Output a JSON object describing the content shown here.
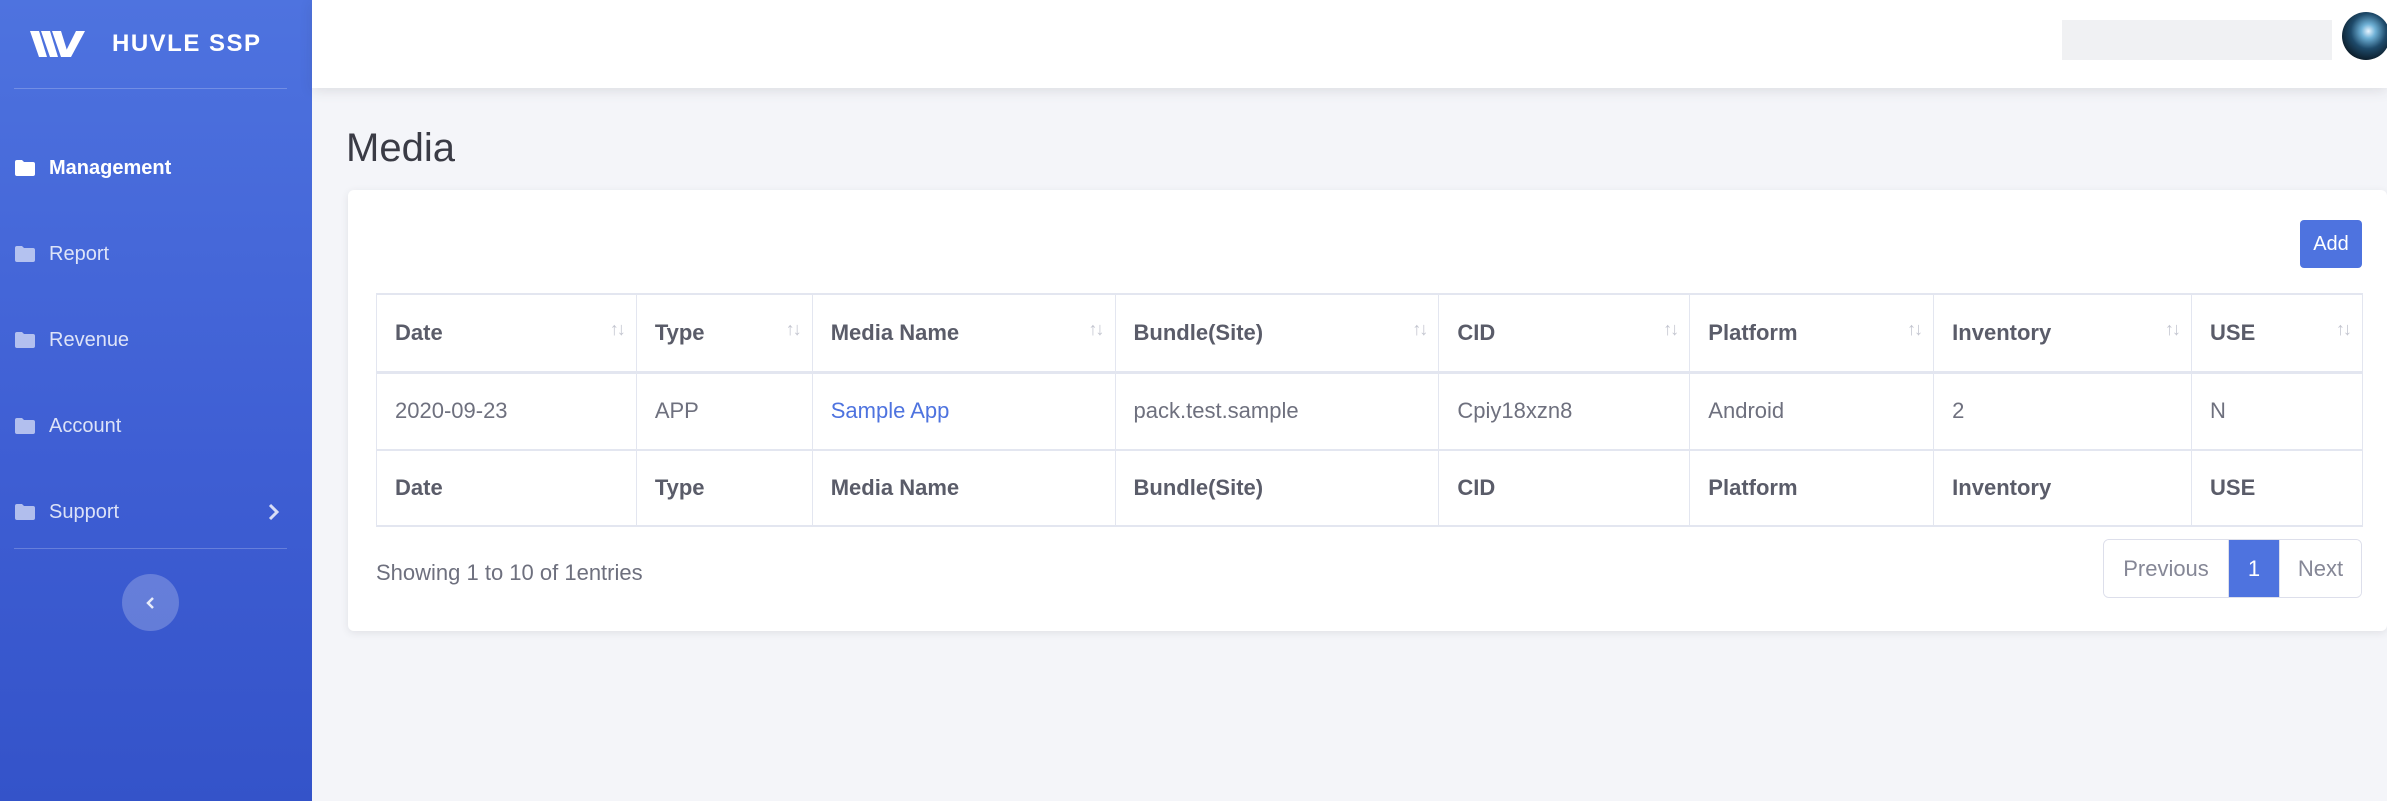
{
  "brand": {
    "name": "HUVLE SSP"
  },
  "sidebar": {
    "items": [
      {
        "label": "Management",
        "icon": "folder-icon",
        "active": true
      },
      {
        "label": "Report",
        "icon": "folder-icon"
      },
      {
        "label": "Revenue",
        "icon": "folder-icon"
      },
      {
        "label": "Account",
        "icon": "folder-icon"
      },
      {
        "label": "Support",
        "icon": "folder-icon",
        "has_submenu": true
      }
    ],
    "toggle_icon": "chevron-left-icon"
  },
  "topbar": {
    "search_value": "",
    "avatar_icon": "user-avatar"
  },
  "page": {
    "title": "Media"
  },
  "toolbar": {
    "add_label": "Add"
  },
  "table": {
    "columns": [
      "Date",
      "Type",
      "Media Name",
      "Bundle(Site)",
      "CID",
      "Platform",
      "Inventory",
      "USE"
    ],
    "rows": [
      {
        "date": "2020-09-23",
        "type": "APP",
        "media_name": "Sample App",
        "bundle": "pack.test.sample",
        "cid": "Cpiy18xzn8",
        "platform": "Android",
        "inventory": "2",
        "use": "N"
      }
    ]
  },
  "footer": {
    "info": "Showing 1 to 10 of 1entries",
    "pagination": {
      "previous": "Previous",
      "current": "1",
      "next": "Next"
    }
  },
  "colors": {
    "primary": "#4e73df",
    "sidebar_bottom": "#3453c9",
    "text": "#5a5c69"
  }
}
